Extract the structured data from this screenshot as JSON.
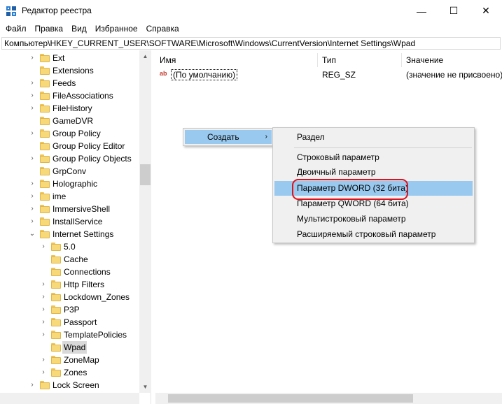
{
  "window": {
    "title": "Редактор реестра",
    "minimize_glyph": "—",
    "maximize_glyph": "☐",
    "close_glyph": "✕"
  },
  "menu": [
    "Файл",
    "Правка",
    "Вид",
    "Избранное",
    "Справка"
  ],
  "address": "Компьютер\\HKEY_CURRENT_USER\\SOFTWARE\\Microsoft\\Windows\\CurrentVersion\\Internet Settings\\Wpad",
  "tree": {
    "items": [
      {
        "label": "Ext",
        "level": 1,
        "chevron": "›"
      },
      {
        "label": "Extensions",
        "level": 1,
        "chevron": ""
      },
      {
        "label": "Feeds",
        "level": 1,
        "chevron": "›"
      },
      {
        "label": "FileAssociations",
        "level": 1,
        "chevron": "›"
      },
      {
        "label": "FileHistory",
        "level": 1,
        "chevron": "›"
      },
      {
        "label": "GameDVR",
        "level": 1,
        "chevron": ""
      },
      {
        "label": "Group Policy",
        "level": 1,
        "chevron": "›"
      },
      {
        "label": "Group Policy Editor",
        "level": 1,
        "chevron": ""
      },
      {
        "label": "Group Policy Objects",
        "level": 1,
        "chevron": "›"
      },
      {
        "label": "GrpConv",
        "level": 1,
        "chevron": ""
      },
      {
        "label": "Holographic",
        "level": 1,
        "chevron": "›"
      },
      {
        "label": "ime",
        "level": 1,
        "chevron": "›"
      },
      {
        "label": "ImmersiveShell",
        "level": 1,
        "chevron": "›"
      },
      {
        "label": "InstallService",
        "level": 1,
        "chevron": "›"
      },
      {
        "label": "Internet Settings",
        "level": 1,
        "chevron": "⌄"
      },
      {
        "label": "5.0",
        "level": 2,
        "chevron": "›"
      },
      {
        "label": "Cache",
        "level": 2,
        "chevron": ""
      },
      {
        "label": "Connections",
        "level": 2,
        "chevron": ""
      },
      {
        "label": "Http Filters",
        "level": 2,
        "chevron": "›"
      },
      {
        "label": "Lockdown_Zones",
        "level": 2,
        "chevron": "›"
      },
      {
        "label": "P3P",
        "level": 2,
        "chevron": "›"
      },
      {
        "label": "Passport",
        "level": 2,
        "chevron": "›"
      },
      {
        "label": "TemplatePolicies",
        "level": 2,
        "chevron": "›"
      },
      {
        "label": "Wpad",
        "level": 2,
        "chevron": "",
        "selected": true
      },
      {
        "label": "ZoneMap",
        "level": 2,
        "chevron": "›"
      },
      {
        "label": "Zones",
        "level": 2,
        "chevron": "›"
      },
      {
        "label": "Lock Screen",
        "level": 1,
        "chevron": "›"
      }
    ]
  },
  "list": {
    "columns": [
      "Имя",
      "Тип",
      "Значение"
    ],
    "rows": [
      {
        "icon": "ab",
        "name": "(По умолчанию)",
        "type": "REG_SZ",
        "value": "(значение не присвоено)"
      }
    ]
  },
  "context_menu": {
    "create_label": "Создать",
    "arrow": "›",
    "submenu": [
      "Раздел",
      "Строковый параметр",
      "Двоичный параметр",
      "Параметр DWORD (32 бита)",
      "Параметр QWORD (64 бита)",
      "Мультистроковый параметр",
      "Расширяемый строковый параметр"
    ]
  },
  "colors": {
    "highlight": "#99c9ef",
    "annotation": "#e0101c",
    "folder": "#f7d97a"
  }
}
